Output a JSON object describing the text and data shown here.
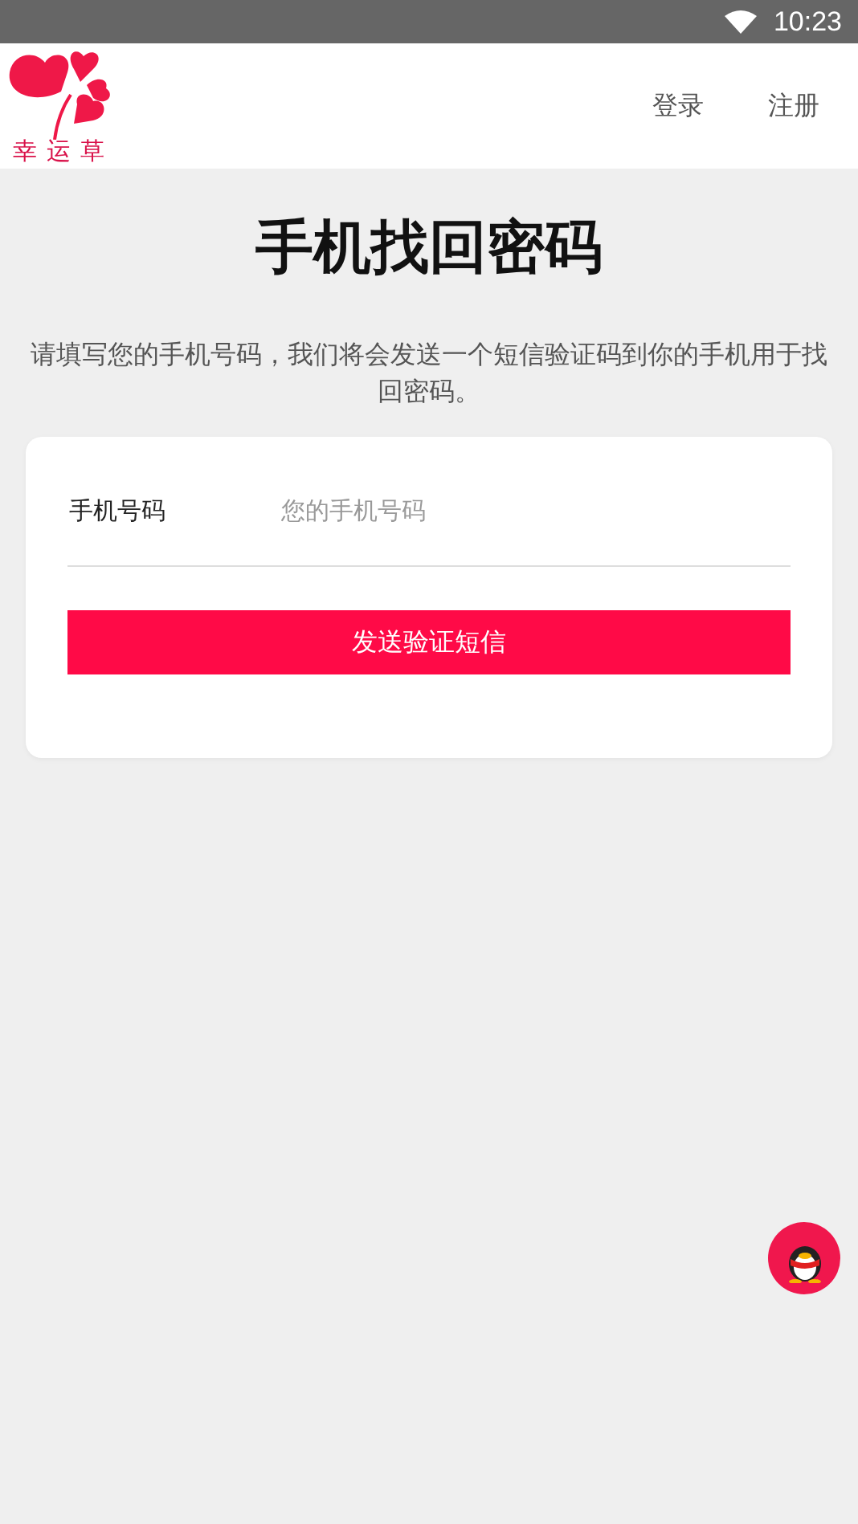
{
  "status_bar": {
    "time": "10:23"
  },
  "header": {
    "logo_text": "幸运草",
    "links": [
      "登录",
      "注册"
    ]
  },
  "title": "手机找回密码",
  "description": "请填写您的手机号码，我们将会发送一个短信验证码到你的手机用于找回密码。",
  "form": {
    "phone": {
      "label": "手机号码",
      "placeholder": "您的手机号码"
    },
    "submit": "发送验证短信"
  }
}
